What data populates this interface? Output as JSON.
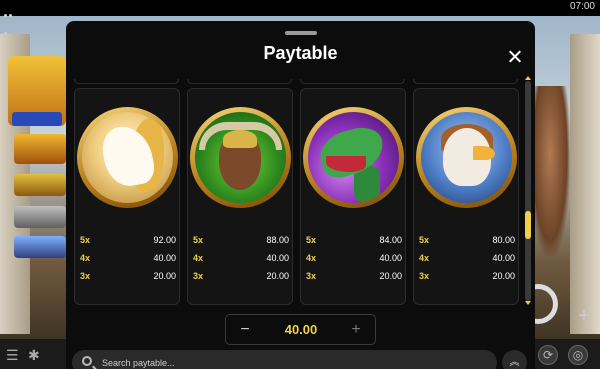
{
  "status_bar": {
    "time": "07:00"
  },
  "modal": {
    "title": "Paytable",
    "close_icon": "close-icon"
  },
  "symbols": [
    {
      "name": "white-horse",
      "icon": "horse-icon",
      "pays": [
        {
          "mult": "5x",
          "value": "92.00"
        },
        {
          "mult": "4x",
          "value": "40.00"
        },
        {
          "mult": "3x",
          "value": "20.00"
        }
      ]
    },
    {
      "name": "golden-bull",
      "icon": "bull-icon",
      "pays": [
        {
          "mult": "5x",
          "value": "88.00"
        },
        {
          "mult": "4x",
          "value": "40.00"
        },
        {
          "mult": "3x",
          "value": "20.00"
        }
      ]
    },
    {
      "name": "green-dragon",
      "icon": "dragon-icon",
      "pays": [
        {
          "mult": "5x",
          "value": "84.00"
        },
        {
          "mult": "4x",
          "value": "40.00"
        },
        {
          "mult": "3x",
          "value": "20.00"
        }
      ]
    },
    {
      "name": "griffin",
      "icon": "griffin-icon",
      "pays": [
        {
          "mult": "5x",
          "value": "80.00"
        },
        {
          "mult": "4x",
          "value": "40.00"
        },
        {
          "mult": "3x",
          "value": "20.00"
        }
      ]
    }
  ],
  "bet": {
    "value": "40.00",
    "minus_label": "−",
    "plus_label": "+"
  },
  "search": {
    "placeholder": "Search paytable...",
    "value": ""
  },
  "scroll_top": {
    "label": "︽"
  },
  "colors": {
    "accent": "#f1cf49",
    "panel": "#0c0c0c",
    "card": "#141414"
  }
}
